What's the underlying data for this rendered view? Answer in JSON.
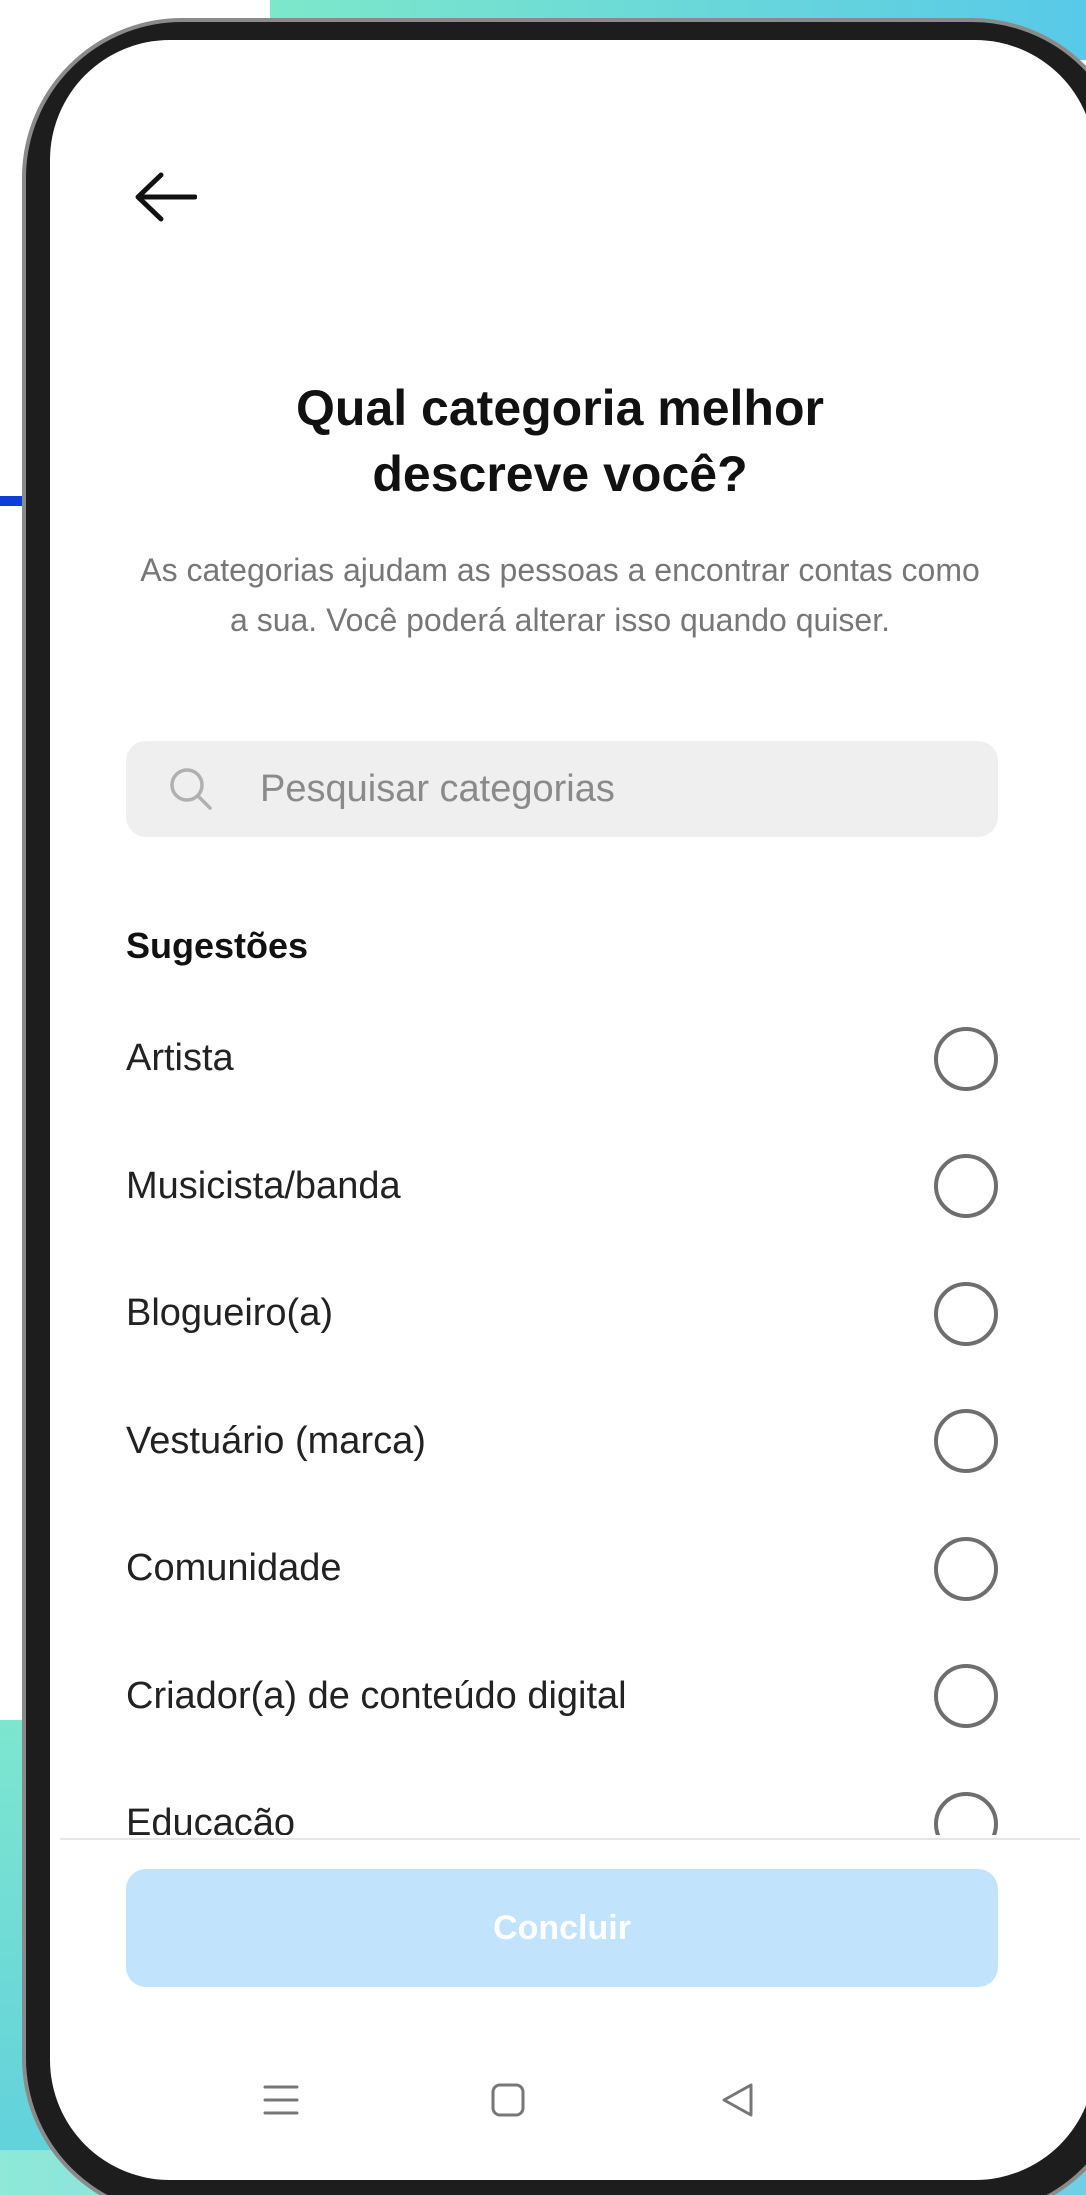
{
  "header": {
    "title_line1": "Qual categoria melhor",
    "title_line2": "descreve você?",
    "subtitle": "As categorias ajudam as pessoas a encontrar contas como a sua. Você poderá alterar isso quando quiser."
  },
  "search": {
    "placeholder": "Pesquisar categorias",
    "icon": "search-icon"
  },
  "suggestions": {
    "label": "Sugestões",
    "items": [
      {
        "label": "Artista",
        "selected": false
      },
      {
        "label": "Musicista/banda",
        "selected": false
      },
      {
        "label": "Blogueiro(a)",
        "selected": false
      },
      {
        "label": "Vestuário (marca)",
        "selected": false
      },
      {
        "label": "Comunidade",
        "selected": false
      },
      {
        "label": "Criador(a) de conteúdo digital",
        "selected": false
      },
      {
        "label": "Educação",
        "selected": false
      }
    ]
  },
  "footer": {
    "done_label": "Concluir",
    "done_color": "#c1e3fb"
  },
  "nav": {
    "icons": [
      "menu-icon",
      "home-square-icon",
      "back-triangle-icon"
    ]
  }
}
